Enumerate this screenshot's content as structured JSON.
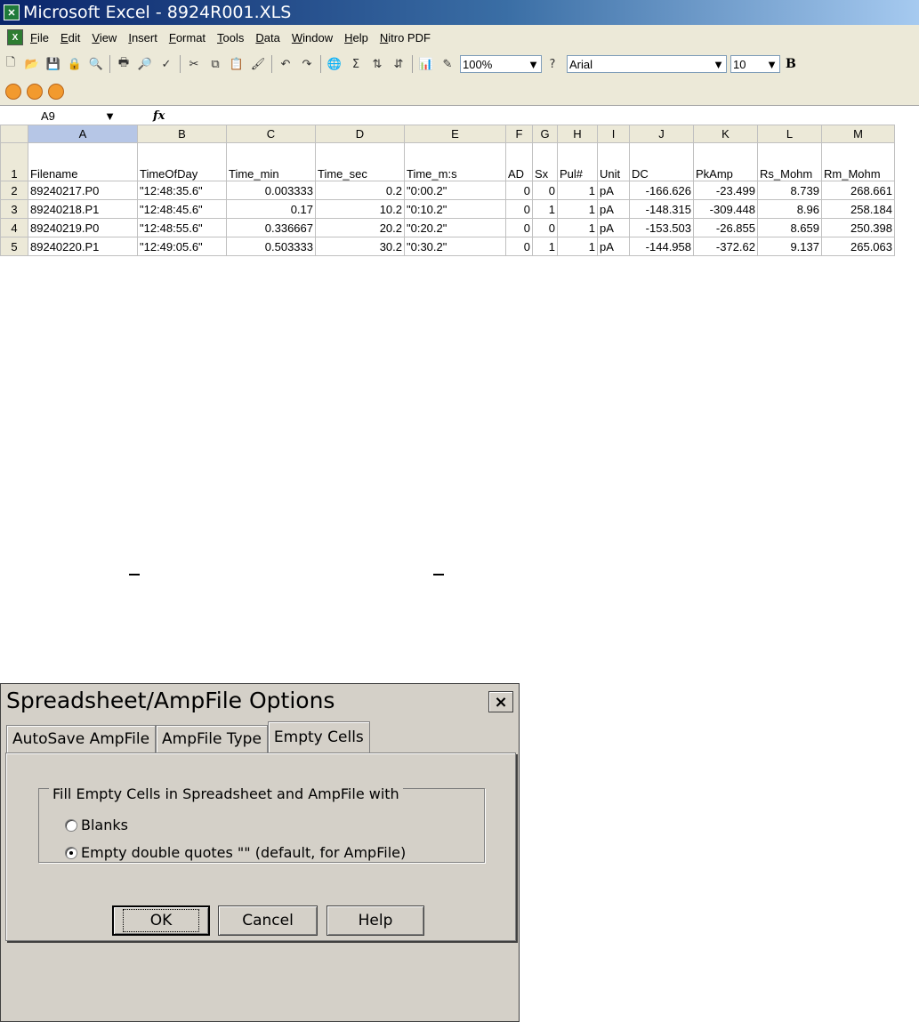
{
  "excel": {
    "title": "Microsoft Excel - 8924R001.XLS",
    "menu": [
      "File",
      "Edit",
      "View",
      "Insert",
      "Format",
      "Tools",
      "Data",
      "Window",
      "Help",
      "Nitro PDF"
    ],
    "toolbar": {
      "zoom": "100%",
      "font": "Arial",
      "size": "10",
      "bold_label": "B"
    },
    "namebox": "A9",
    "fx_label": "fx",
    "columns": [
      "A",
      "B",
      "C",
      "D",
      "E",
      "F",
      "G",
      "H",
      "I",
      "J",
      "K",
      "L",
      "M"
    ],
    "rows": [
      {
        "num": "1",
        "cells": [
          "Filename",
          "TimeOfDay",
          "Time_min",
          "Time_sec",
          "Time_m:s",
          "AD",
          "Sx",
          "Pul#",
          "Unit",
          "DC",
          "PkAmp",
          "Rs_Mohm",
          "Rm_Mohm"
        ]
      },
      {
        "num": "2",
        "cells": [
          "89240217.P0",
          "\"12:48:35.6\"",
          "0.003333",
          "0.2",
          "\"0:00.2\"",
          "0",
          "0",
          "1",
          "pA",
          "-166.626",
          "-23.499",
          "8.739",
          "268.661"
        ]
      },
      {
        "num": "3",
        "cells": [
          "89240218.P1",
          "\"12:48:45.6\"",
          "0.17",
          "10.2",
          "\"0:10.2\"",
          "0",
          "1",
          "1",
          "pA",
          "-148.315",
          "-309.448",
          "8.96",
          "258.184"
        ]
      },
      {
        "num": "4",
        "cells": [
          "89240219.P0",
          "\"12:48:55.6\"",
          "0.336667",
          "20.2",
          "\"0:20.2\"",
          "0",
          "0",
          "1",
          "pA",
          "-153.503",
          "-26.855",
          "8.659",
          "250.398"
        ]
      },
      {
        "num": "5",
        "cells": [
          "89240220.P1",
          "\"12:49:05.6\"",
          "0.503333",
          "30.2",
          "\"0:30.2\"",
          "0",
          "1",
          "1",
          "pA",
          "-144.958",
          "-372.62",
          "9.137",
          "265.063"
        ]
      }
    ]
  },
  "dialog": {
    "title": "Spreadsheet/AmpFile Options",
    "close_label": "×",
    "tabs": [
      "AutoSave AmpFile",
      "AmpFile Type",
      "Empty Cells"
    ],
    "active_tab": "Empty Cells",
    "group_label": "Fill Empty Cells in Spreadsheet and AmpFile with",
    "options": [
      {
        "label": "Blanks",
        "selected": false
      },
      {
        "label": "Empty double quotes \"\" (default, for AmpFile)",
        "selected": true
      }
    ],
    "buttons": {
      "ok": "OK",
      "cancel": "Cancel",
      "help": "Help"
    }
  }
}
